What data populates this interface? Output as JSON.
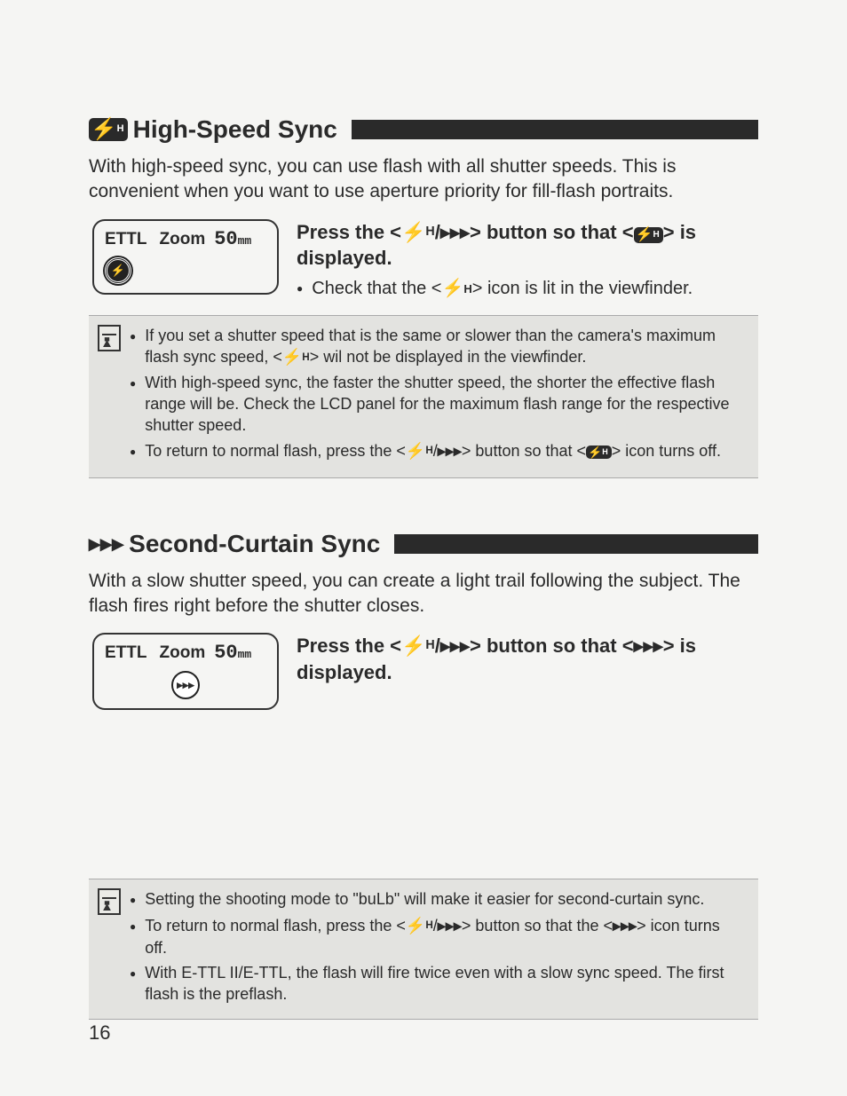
{
  "section1": {
    "title": "High-Speed Sync",
    "intro": "With high-speed sync, you can use flash with all shutter speeds. This is convenient when you want to use aperture priority for fill-flash portraits.",
    "lcd": {
      "ettl": "ETTL",
      "zoom": "Zoom",
      "mm_num": "50",
      "mm_unit": "mm"
    },
    "instr_line1": "Press the <⚡H/▸▸▸> button so that",
    "instr_line2_prefix": "<",
    "instr_line2_suffix": "> is displayed.",
    "check": "Check that the <⚡H> icon is lit in the viewfinder.",
    "notes": [
      "If you set a shutter speed that is the same or slower than the camera's maximum flash sync speed, <⚡H> wil not be displayed in the viewfinder.",
      "With high-speed sync, the faster the shutter speed, the shorter the effective flash range will be. Check the LCD panel for the maximum flash range for the respective shutter speed.",
      "To return to normal flash, press the <⚡H/▸▸▸> button so that <⚡H (badge)> icon turns off."
    ]
  },
  "section2": {
    "title": "Second-Curtain Sync",
    "intro": "With a slow shutter speed, you can create a light trail following the subject. The flash fires right before the shutter closes.",
    "lcd": {
      "ettl": "ETTL",
      "zoom": "Zoom",
      "mm_num": "50",
      "mm_unit": "mm"
    },
    "instr_line1": "Press the <⚡H/▸▸▸> button so that",
    "instr_line2": "<▸▸▸> is displayed.",
    "notes": [
      "Setting the shooting mode to \"buLb\" will make it easier for second-curtain sync.",
      "To return to normal flash, press the <⚡H/▸▸▸> button so that the <▸▸▸> icon turns off.",
      "With E-TTL II/E-TTL, the flash will fire twice even with a slow sync speed. The first flash is the preflash."
    ]
  },
  "page": "16"
}
